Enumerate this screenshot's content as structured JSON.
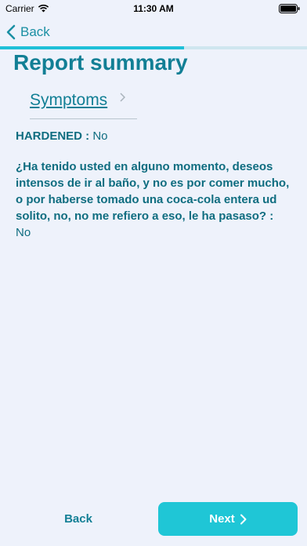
{
  "status_bar": {
    "carrier": "Carrier",
    "time": "11:30 AM"
  },
  "nav": {
    "back_label": "Back"
  },
  "progress": {
    "value": 0.6,
    "track_color": "#cfe6ef",
    "fill_color": "#1fc0d8"
  },
  "page": {
    "title": "Report summary"
  },
  "section": {
    "link_label": "Symptoms"
  },
  "answers": [
    {
      "question": "HARDENED :",
      "answer": "No"
    },
    {
      "question": "¿Ha tenido usted en alguno momento, deseos intensos de ir al baño, y no es por comer mucho, o por haberse tomado una coca-cola entera ud solito, no, no me refiero a eso, le ha pasaso? :",
      "answer": "No"
    }
  ],
  "footer": {
    "back_label": "Back",
    "next_label": "Next"
  },
  "colors": {
    "accent": "#127f95",
    "button": "#1fc6d6",
    "background": "#eef2fb"
  }
}
